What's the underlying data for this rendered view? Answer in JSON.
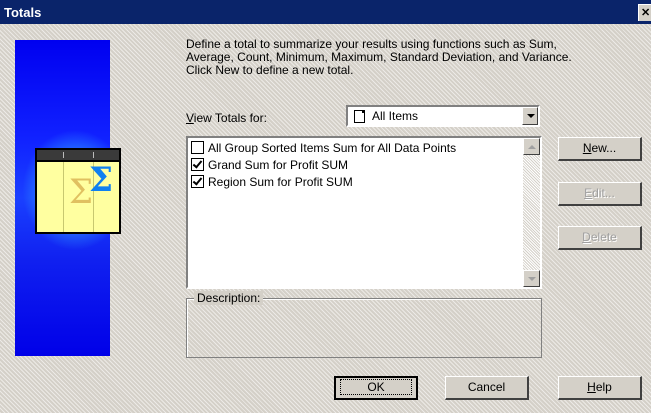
{
  "window": {
    "title": "Totals",
    "close_label": "✕"
  },
  "intro_lines": [
    "Define a total to summarize your results using functions such as Sum,",
    "Average, Count, Minimum, Maximum, Standard Deviation, and Variance.",
    "Click New to define a new total."
  ],
  "view_totals": {
    "label_prefix": "",
    "label_underlined": "V",
    "label_rest": "iew Totals for:",
    "selected": "All Items"
  },
  "totals_list": [
    {
      "label": "All Group Sorted Items Sum for All Data Points",
      "checked": false
    },
    {
      "label": "Grand Sum for Profit SUM",
      "checked": true
    },
    {
      "label": "Region Sum for Profit SUM",
      "checked": true
    }
  ],
  "buttons": {
    "new_underlined": "N",
    "new_rest": "ew...",
    "edit_underlined": "E",
    "edit_rest": "dit...",
    "delete_underlined": "D",
    "delete_rest": "elete",
    "ok": "OK",
    "cancel": "Cancel",
    "help_underlined": "H",
    "help_rest": "elp"
  },
  "description": {
    "legend": "Description:",
    "text": ""
  },
  "icons": {
    "sidebar": "sigma-totals-icon",
    "combo": "document-icon",
    "dropdown": "chevron-down-icon"
  },
  "colors": {
    "titlebar": "#0a246a",
    "sidebar": "#1020ff",
    "face": "#d4d0c8"
  }
}
